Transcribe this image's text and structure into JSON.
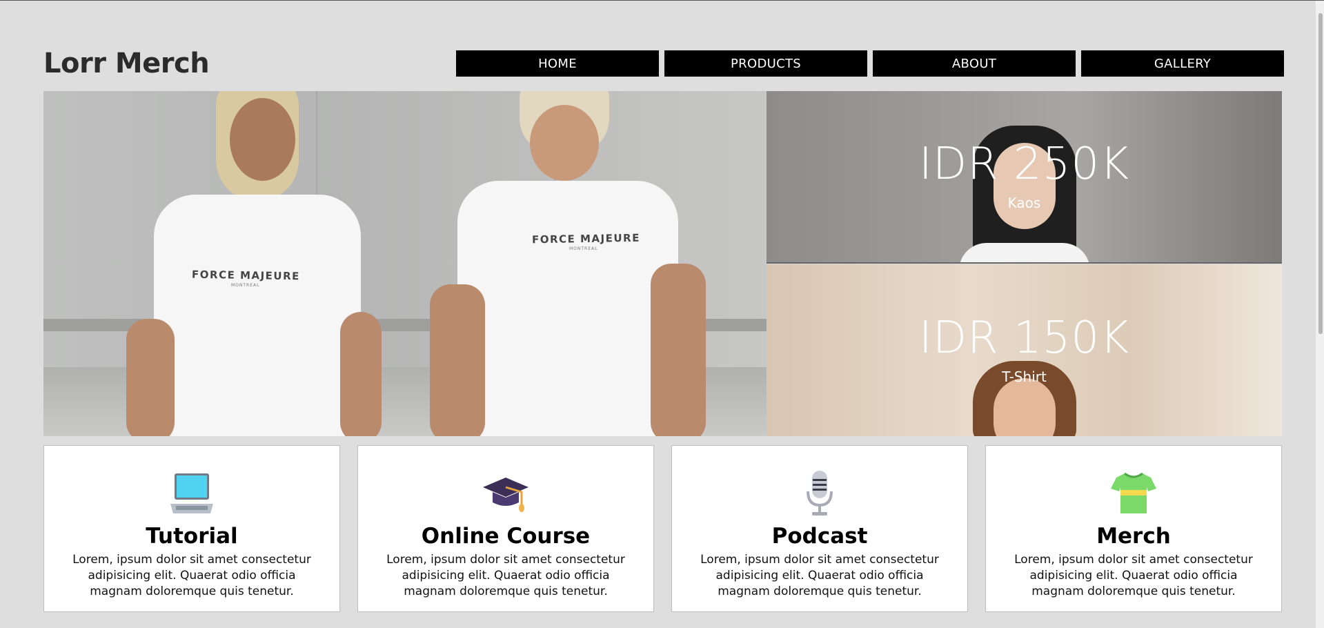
{
  "header": {
    "logo": "Lorr Merch",
    "nav": [
      {
        "label": "HOME"
      },
      {
        "label": "PRODUCTS"
      },
      {
        "label": "ABOUT"
      },
      {
        "label": "GALLERY"
      }
    ]
  },
  "hero": {
    "shirt_print": "FORCE MAJEURE",
    "shirt_sub": "MONTREAL"
  },
  "promos": [
    {
      "price": "IDR 250K",
      "label": "Kaos"
    },
    {
      "price": "IDR 150K",
      "label": "T-Shirt"
    }
  ],
  "cards": [
    {
      "icon": "laptop-icon",
      "title": "Tutorial",
      "text": "Lorem, ipsum dolor sit amet consectetur adipisicing elit. Quaerat odio officia magnam doloremque quis tenetur."
    },
    {
      "icon": "graduation-cap-icon",
      "title": "Online Course",
      "text": "Lorem, ipsum dolor sit amet consectetur adipisicing elit. Quaerat odio officia magnam doloremque quis tenetur."
    },
    {
      "icon": "microphone-icon",
      "title": "Podcast",
      "text": "Lorem, ipsum dolor sit amet consectetur adipisicing elit. Quaerat odio officia magnam doloremque quis tenetur."
    },
    {
      "icon": "tshirt-icon",
      "title": "Merch",
      "text": "Lorem, ipsum dolor sit amet consectetur adipisicing elit. Quaerat odio officia magnam doloremque quis tenetur."
    }
  ]
}
